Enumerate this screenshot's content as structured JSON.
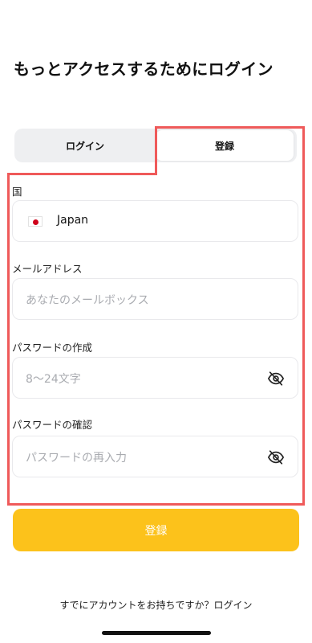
{
  "header": {
    "title": "もっとアクセスするためにログイン"
  },
  "tabs": [
    {
      "label": "ログイン",
      "active": false
    },
    {
      "label": "登録",
      "active": true
    }
  ],
  "form": {
    "country": {
      "label": "国",
      "value": "Japan",
      "flag_icon": "japan-flag-icon"
    },
    "email": {
      "label": "メールアドレス",
      "placeholder": "あなたのメールボックス"
    },
    "password": {
      "label": "パスワードの作成",
      "placeholder": "8～24文字",
      "icon": "eye-off-icon"
    },
    "confirm": {
      "label": "パスワードの確認",
      "placeholder": "パスワードの再入力",
      "icon": "eye-off-icon"
    }
  },
  "submit": {
    "label": "登録"
  },
  "footer": {
    "text": "すでにアカウントをお持ちですか？ログイン"
  },
  "colors": {
    "accent": "#fcc21b",
    "highlight": "#ef5a5a",
    "placeholder": "#a9abb0"
  }
}
